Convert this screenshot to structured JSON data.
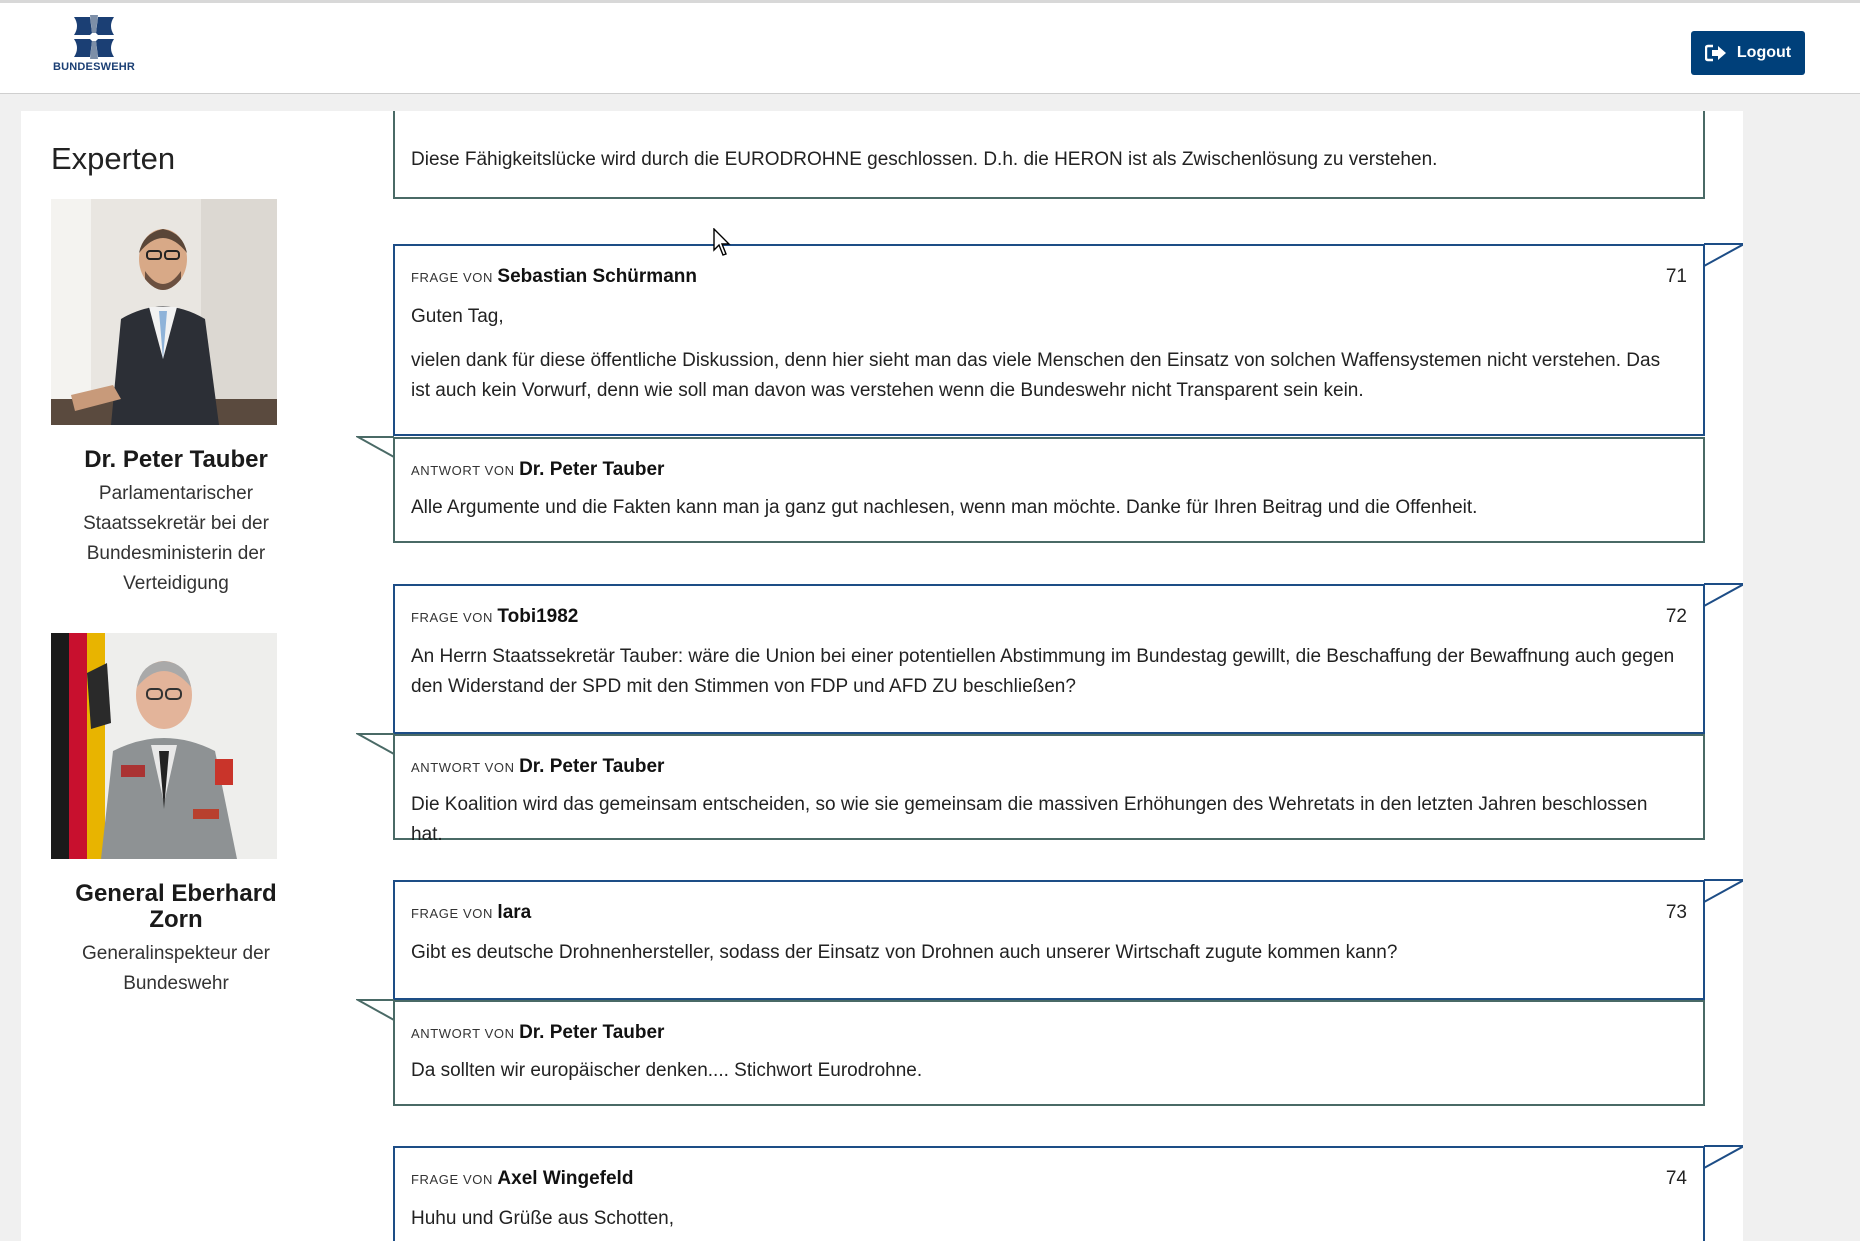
{
  "header": {
    "logo_text": "BUNDESWEHR",
    "logout_label": "Logout"
  },
  "experts": {
    "title": "Experten",
    "people": [
      {
        "name": "Dr. Peter Tauber",
        "role": "Parlamentarischer Staatssekretär bei der Bundesministerin der Verteidigung"
      },
      {
        "name": "General Eberhard Zorn",
        "role": "Generalinspekteur der Bundeswehr"
      }
    ]
  },
  "labels": {
    "frage_von": "Frage von",
    "antwort_von": "Antwort von"
  },
  "feed": {
    "prev_answer_text": "Diese Fähigkeitslücke wird durch die EURODROHNE geschlossen. D.h. die HERON ist als Zwischenlösung zu verstehen.",
    "items": [
      {
        "number": "71",
        "question_author": "Sebastian Schürmann",
        "question_paragraphs": [
          "Guten Tag,",
          "vielen dank für diese öffentliche Diskussion, denn hier sieht man das viele Menschen den Einsatz von solchen Waffensystemen nicht verstehen. Das ist auch kein Vorwurf, denn wie soll man davon was verstehen wenn die Bundeswehr nicht Transparent sein kein."
        ],
        "answer_author": "Dr. Peter Tauber",
        "answer_text": "Alle Argumente und die Fakten kann man ja ganz gut nachlesen, wenn man möchte. Danke für Ihren Beitrag und die Offenheit."
      },
      {
        "number": "72",
        "question_author": "Tobi1982",
        "question_paragraphs": [
          "An Herrn Staatssekretär Tauber: wäre die Union bei einer potentiellen Abstimmung im Bundestag gewillt, die Beschaffung der Bewaffnung auch gegen den Widerstand der SPD mit den Stimmen von FDP und AFD ZU beschließen?"
        ],
        "answer_author": "Dr. Peter Tauber",
        "answer_text": "Die Koalition wird das gemeinsam entscheiden, so wie sie gemeinsam die massiven Erhöhungen des Wehretats in den letzten Jahren beschlossen hat."
      },
      {
        "number": "73",
        "question_author": "lara",
        "question_paragraphs": [
          "Gibt es deutsche Drohnenhersteller, sodass der Einsatz von Drohnen auch unserer Wirtschaft zugute kommen kann?"
        ],
        "answer_author": "Dr. Peter Tauber",
        "answer_text": "Da sollten wir europäischer denken.... Stichwort Eurodrohne."
      },
      {
        "number": "74",
        "question_author": "Axel Wingefeld",
        "question_paragraphs": [
          "Huhu und Grüße aus Schotten,"
        ]
      }
    ]
  }
}
